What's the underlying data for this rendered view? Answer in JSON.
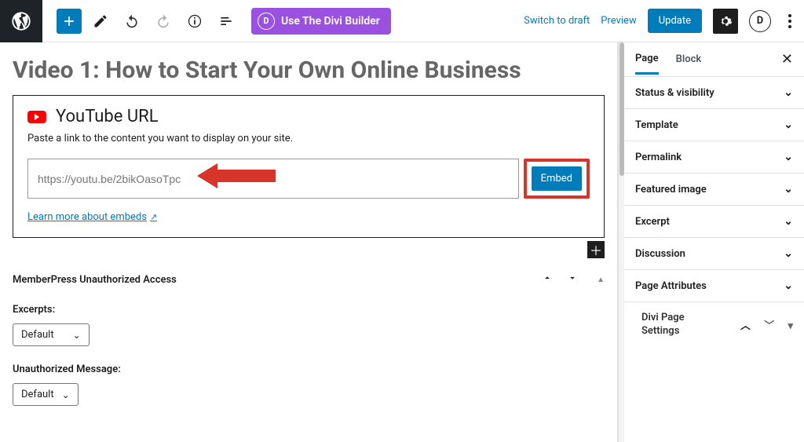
{
  "topbar": {
    "divi_button": "Use The Divi Builder",
    "switch_draft": "Switch to draft",
    "preview": "Preview",
    "update": "Update"
  },
  "page": {
    "title": "Video 1: How to Start Your Own Online Business"
  },
  "block": {
    "heading": "YouTube URL",
    "desc": "Paste a link to the content you want to display on your site.",
    "url_placeholder": "https://youtu.be/2bikOasoTpc",
    "embed": "Embed",
    "learn_more": "Learn more about embeds"
  },
  "memberpress": {
    "heading": "MemberPress Unauthorized Access",
    "excerpts_label": "Excerpts:",
    "excerpts_value": "Default",
    "unauth_label": "Unauthorized Message:",
    "unauth_value": "Default"
  },
  "sidebar": {
    "tabs": {
      "page": "Page",
      "block": "Block"
    },
    "panels": {
      "status": "Status & visibility",
      "template": "Template",
      "permalink": "Permalink",
      "featured": "Featured image",
      "excerpt": "Excerpt",
      "discussion": "Discussion",
      "attributes": "Page Attributes",
      "divi": "Divi Page Settings"
    }
  }
}
